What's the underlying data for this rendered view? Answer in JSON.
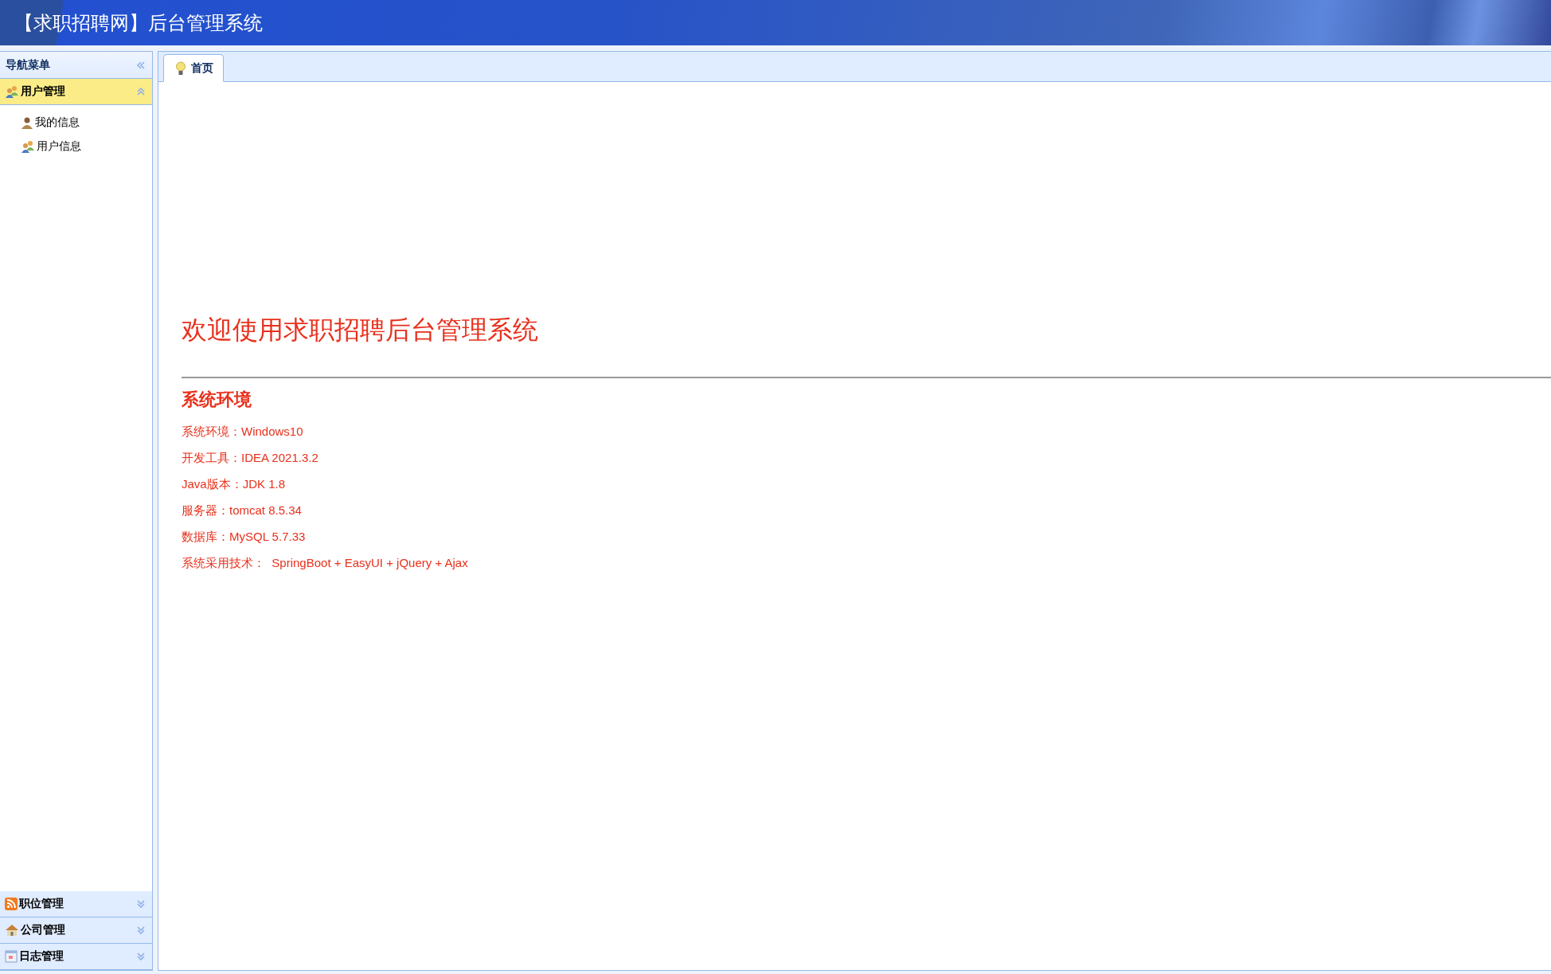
{
  "header": {
    "title": "【求职招聘网】后台管理系统"
  },
  "sidebar": {
    "title": "导航菜单",
    "sections": [
      {
        "label": "用户管理",
        "expanded": true,
        "items": [
          {
            "label": "我的信息"
          },
          {
            "label": "用户信息"
          }
        ]
      },
      {
        "label": "职位管理",
        "expanded": false
      },
      {
        "label": "公司管理",
        "expanded": false
      },
      {
        "label": "日志管理",
        "expanded": false
      }
    ]
  },
  "tabs": [
    {
      "label": "首页",
      "selected": true
    }
  ],
  "welcome": {
    "title": "欢迎使用求职招聘后台管理系统",
    "heading": "系统环境",
    "lines": [
      "系统环境：Windows10",
      "开发工具：IDEA 2021.3.2",
      "Java版本：JDK 1.8",
      "服务器：tomcat 8.5.34",
      "数据库：MySQL 5.7.33",
      "系统采用技术：  SpringBoot + EasyUI + jQuery + Ajax"
    ]
  }
}
